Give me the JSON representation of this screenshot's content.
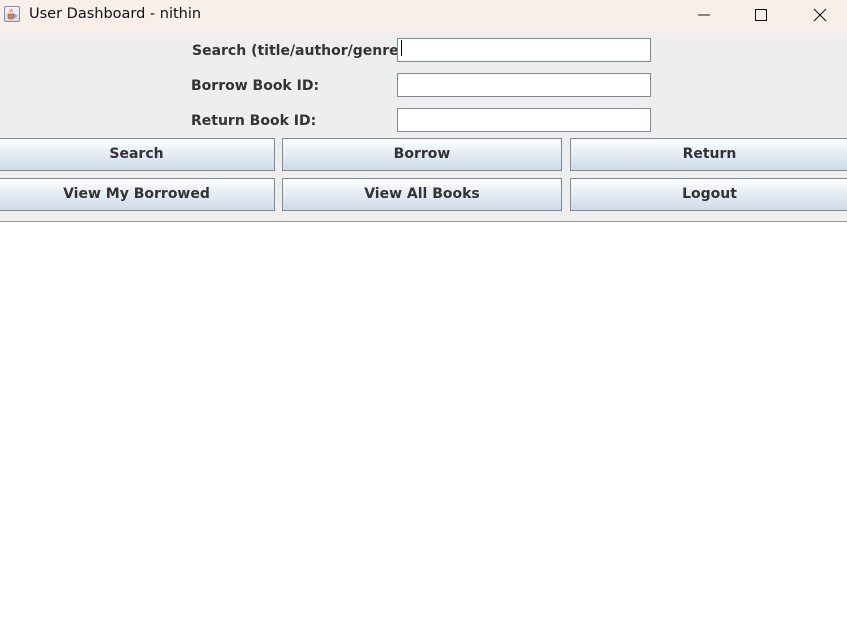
{
  "window": {
    "title": "User Dashboard - nithin",
    "icon": "java-cup-icon"
  },
  "form": {
    "search_label": "Search (title/author/genre):",
    "search_value": "",
    "borrow_label": "Borrow Book ID:",
    "borrow_value": "",
    "return_label": "Return Book ID:",
    "return_value": ""
  },
  "buttons": {
    "search": "Search",
    "borrow": "Borrow",
    "return": "Return",
    "view_borrowed": "View My Borrowed",
    "view_all": "View All Books",
    "logout": "Logout"
  },
  "colors": {
    "titlebar_bg": "#f8efeb",
    "panel_bg": "#eeeeee",
    "content_bg": "#ffffff",
    "button_gradient_top": "#ffffff",
    "button_gradient_bottom": "#cfdbe8",
    "label_text": "#333333"
  }
}
